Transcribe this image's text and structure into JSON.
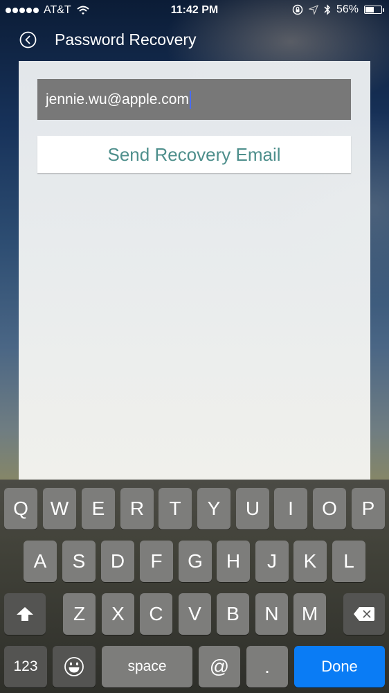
{
  "status_bar": {
    "signal_dots": 5,
    "carrier": "AT&T",
    "time": "11:42 PM",
    "battery_percent_label": "56%",
    "battery_level": 0.56,
    "icons": [
      "wifi-icon",
      "orientation-lock-icon",
      "location-icon",
      "bluetooth-icon",
      "battery-icon"
    ]
  },
  "nav": {
    "back_icon": "back-circle-icon",
    "title": "Password Recovery"
  },
  "form": {
    "email_value": "jennie.wu@apple.com",
    "send_button_label": "Send Recovery Email"
  },
  "keyboard": {
    "row1": [
      "Q",
      "W",
      "E",
      "R",
      "T",
      "Y",
      "U",
      "I",
      "O",
      "P"
    ],
    "row2": [
      "A",
      "S",
      "D",
      "F",
      "G",
      "H",
      "J",
      "K",
      "L"
    ],
    "row3": [
      "Z",
      "X",
      "C",
      "V",
      "B",
      "N",
      "M"
    ],
    "shift_icon": "shift-arrow-icon",
    "delete_icon": "backspace-icon",
    "numbers_label": "123",
    "emoji_icon": "emoji-icon",
    "space_label": "space",
    "at_label": "@",
    "dot_label": ".",
    "done_label": "Done"
  },
  "colors": {
    "done_button": "#0a7cf5",
    "send_button_text": "#4e8f8c",
    "email_field_bg": "#787878",
    "caret": "#4a6cf0"
  }
}
